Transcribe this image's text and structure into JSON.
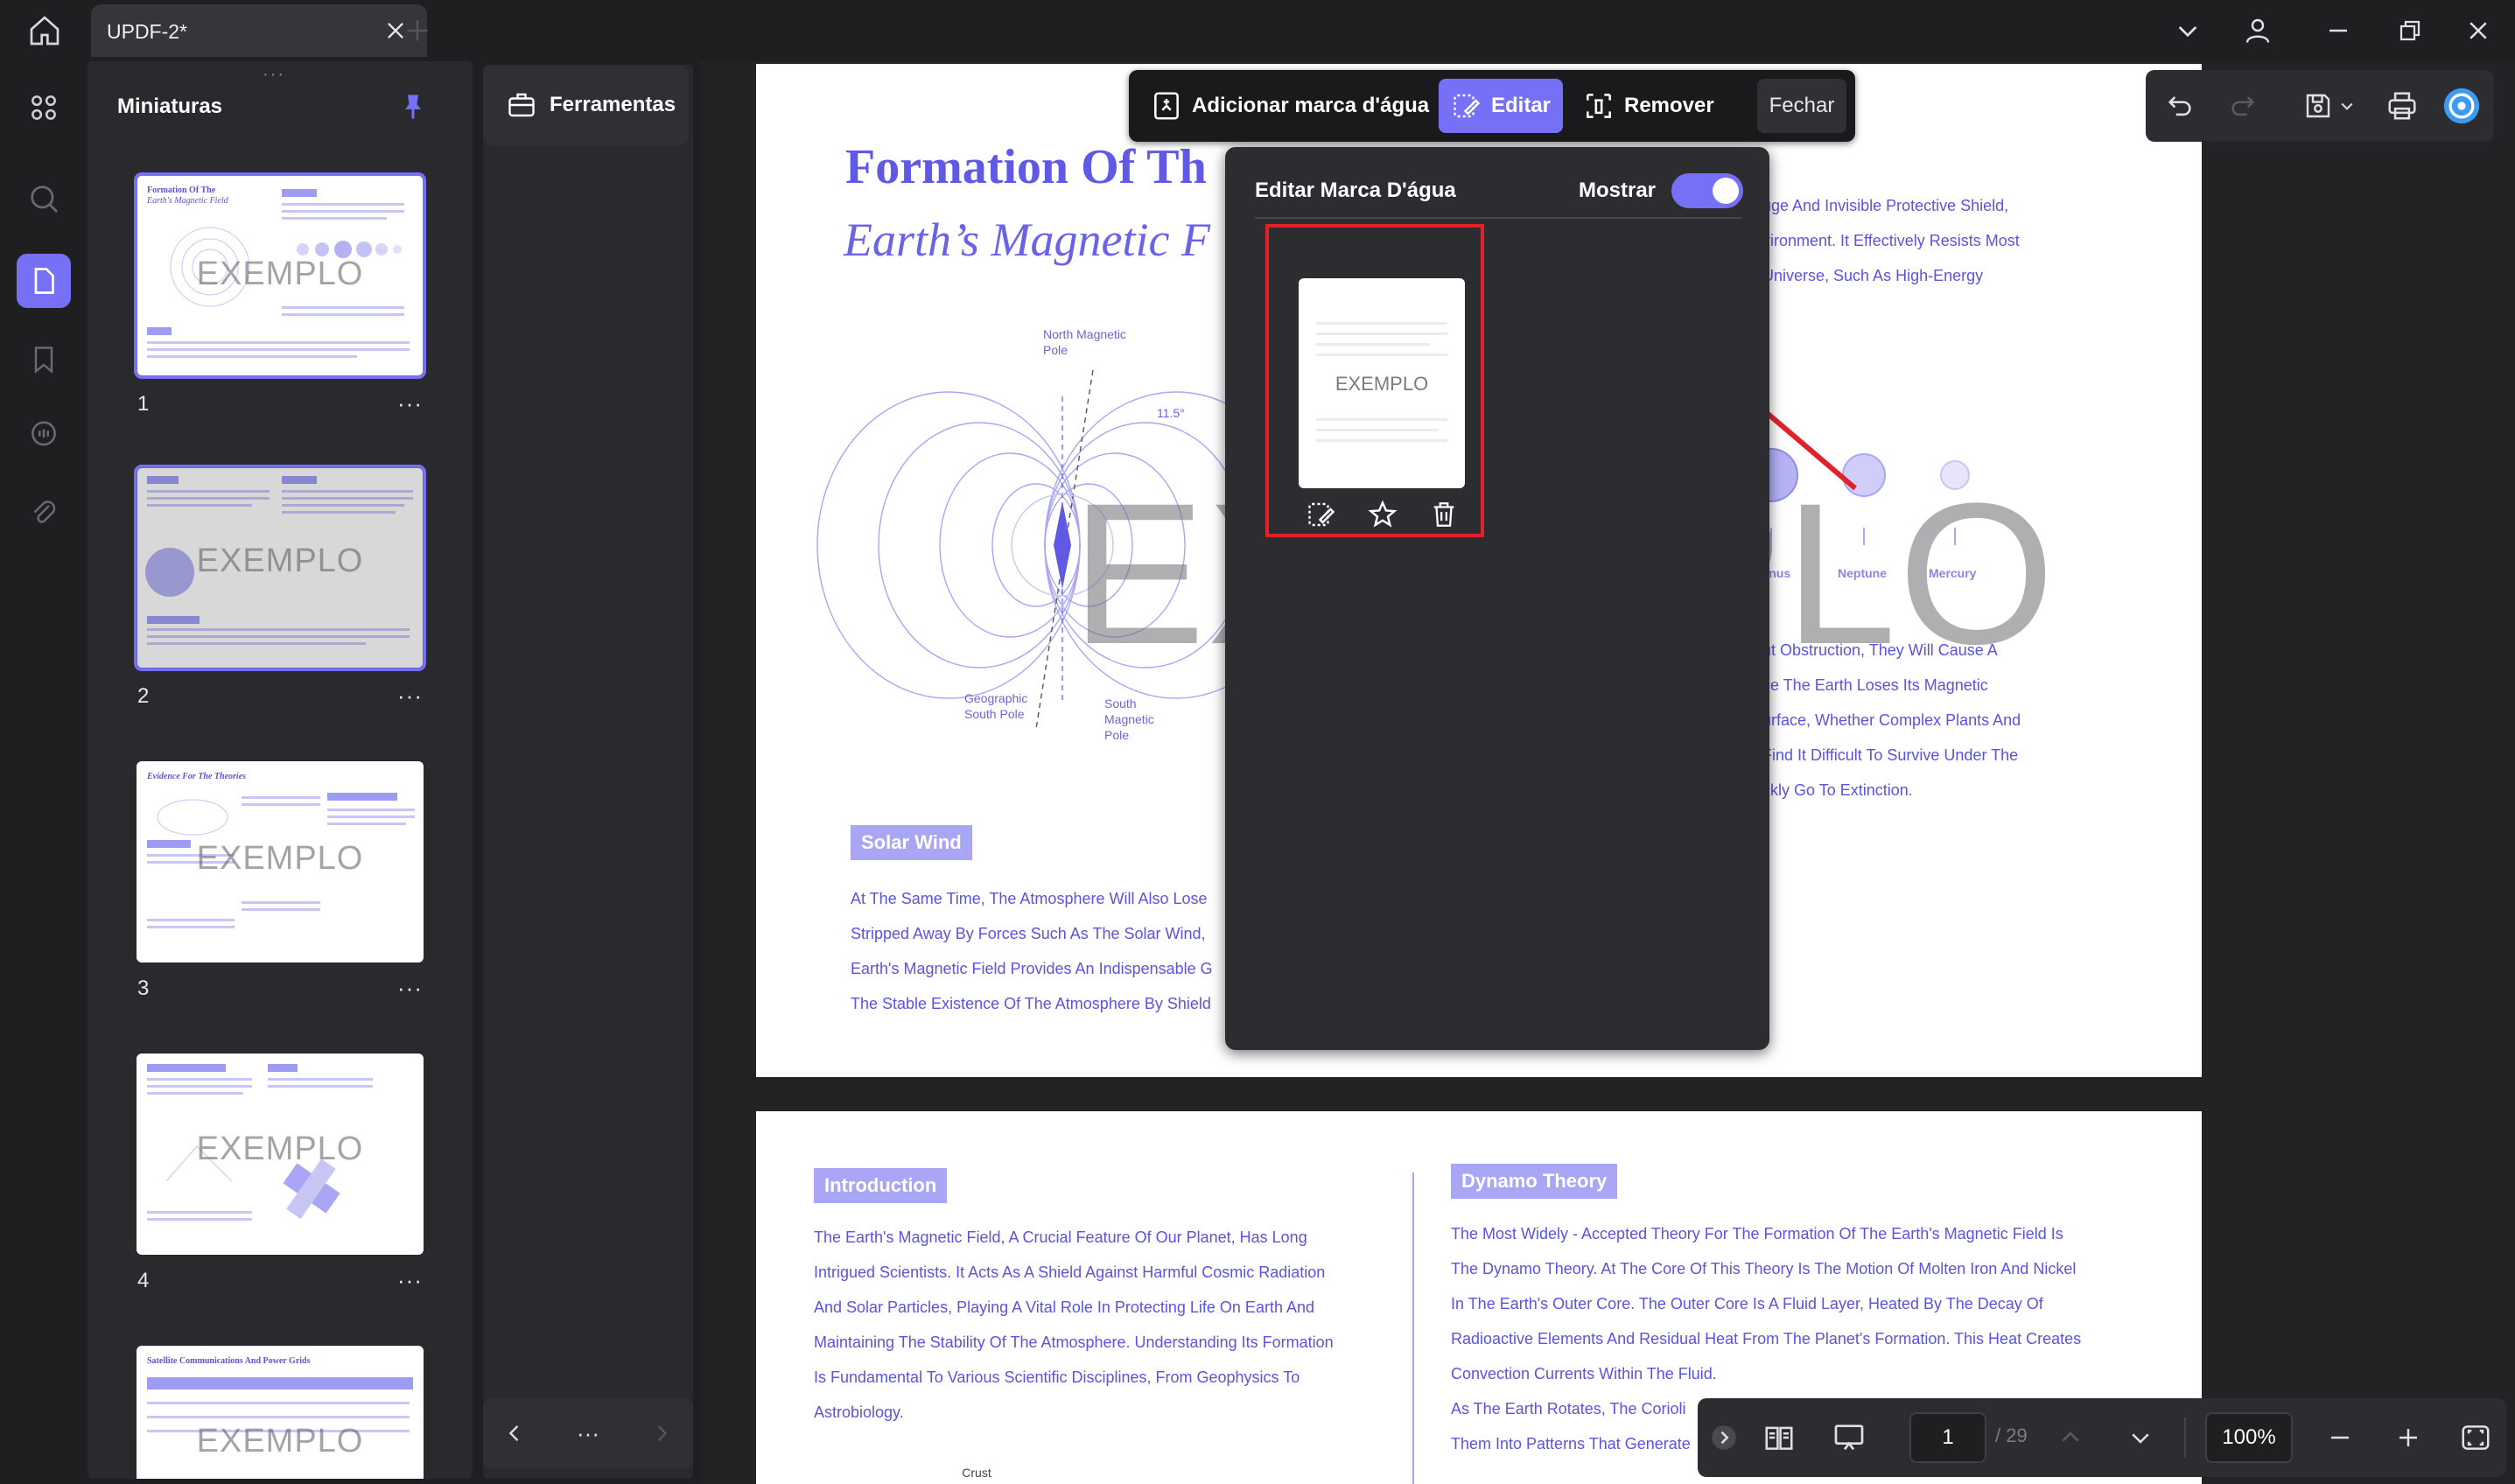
{
  "titlebar": {
    "tab_name": "UPDF-2*"
  },
  "thumbnails": {
    "title": "Miniaturas",
    "more_label": "···",
    "pages": [
      {
        "number": "1",
        "heading": "Formation Of The",
        "heading2": "Earth's Magnetic Field",
        "watermark": "EXEMPLO"
      },
      {
        "number": "2",
        "heading": "",
        "heading2": "",
        "watermark": "EXEMPLO"
      },
      {
        "number": "3",
        "heading": "Evidence For The Theories",
        "heading2": "",
        "watermark": "EXEMPLO"
      },
      {
        "number": "4",
        "heading": "",
        "heading2": "",
        "watermark": "EXEMPLO"
      },
      {
        "number": "",
        "heading": "Satellite Communications And Power Grids",
        "heading2": "",
        "watermark": "EXEMPLO"
      }
    ]
  },
  "tools": {
    "label": "Ferramentas",
    "bottom_more": "···"
  },
  "watermark_toolbar": {
    "add_label": "Adicionar marca d'água",
    "edit_label": "Editar",
    "remove_label": "Remover",
    "close_label": "Fechar"
  },
  "watermark_panel": {
    "title": "Editar Marca D'água",
    "show_label": "Mostrar",
    "show_enabled": true,
    "card_label": "EXEMPLO"
  },
  "page1": {
    "title": "Formation Of Th",
    "subtitle": "Earth’s Magnetic F",
    "watermark": "EXEMPLO",
    "right_text": [
      "uge And Invisible Protective Shield,",
      "vironment. It Effectively Resists Most",
      "Universe, Such As High-Energy"
    ],
    "right_text2": [
      "ut Obstruction, They Will Cause A",
      "ce The Earth Loses Its Magnetic",
      "urface, Whether Complex Plants And",
      "Find It Difficult To Survive Under The",
      "ckly Go To Extinction."
    ],
    "diagram_labels": {
      "north": "North Magnetic Pole",
      "geo_south": "Geographic South Pole",
      "south": "South Magnetic Pole",
      "angle": "11.5°"
    },
    "planets": [
      "Uranus",
      "Neptune",
      "Mercury"
    ],
    "solar_wind_tag": "Solar Wind",
    "solar_wind_text": [
      "At The Same Time, The Atmosphere Will Also Lose",
      "Stripped Away By Forces Such As The Solar Wind,",
      "Earth's Magnetic Field Provides An Indispensable G",
      "The Stable Existence Of The Atmosphere By Shield"
    ]
  },
  "page2": {
    "intro_tag": "Introduction",
    "intro_text": [
      "The Earth's Magnetic Field, A Crucial Feature Of Our Planet, Has Long",
      "Intrigued Scientists. It Acts As A Shield Against Harmful Cosmic Radiation",
      "And Solar Particles, Playing A Vital Role In Protecting Life On Earth And",
      "Maintaining The Stability Of The Atmosphere. Understanding Its Formation",
      "Is Fundamental To Various Scientific Disciplines, From Geophysics To",
      "Astrobiology."
    ],
    "crust_label": "Crust",
    "dynamo_tag": "Dynamo Theory",
    "dynamo_text": [
      "The Most Widely - Accepted Theory For The Formation Of The Earth's Magnetic Field Is",
      "The Dynamo Theory. At The Core Of This Theory Is The Motion Of Molten Iron And Nickel",
      "In The Earth's Outer Core. The Outer Core Is A Fluid Layer, Heated By The Decay Of",
      "Radioactive Elements And Residual Heat From The Planet's Formation. This Heat Creates",
      "Convection Currents Within The Fluid.",
      "As The Earth Rotates, The Corioli",
      "Them Into Patterns That Generate"
    ]
  },
  "navbar": {
    "page_current": "1",
    "page_total": "/ 29",
    "zoom": "100%"
  },
  "colors": {
    "accent": "#7570f5",
    "highlight_red": "#e0232b",
    "doc_text": "#5a54df"
  }
}
